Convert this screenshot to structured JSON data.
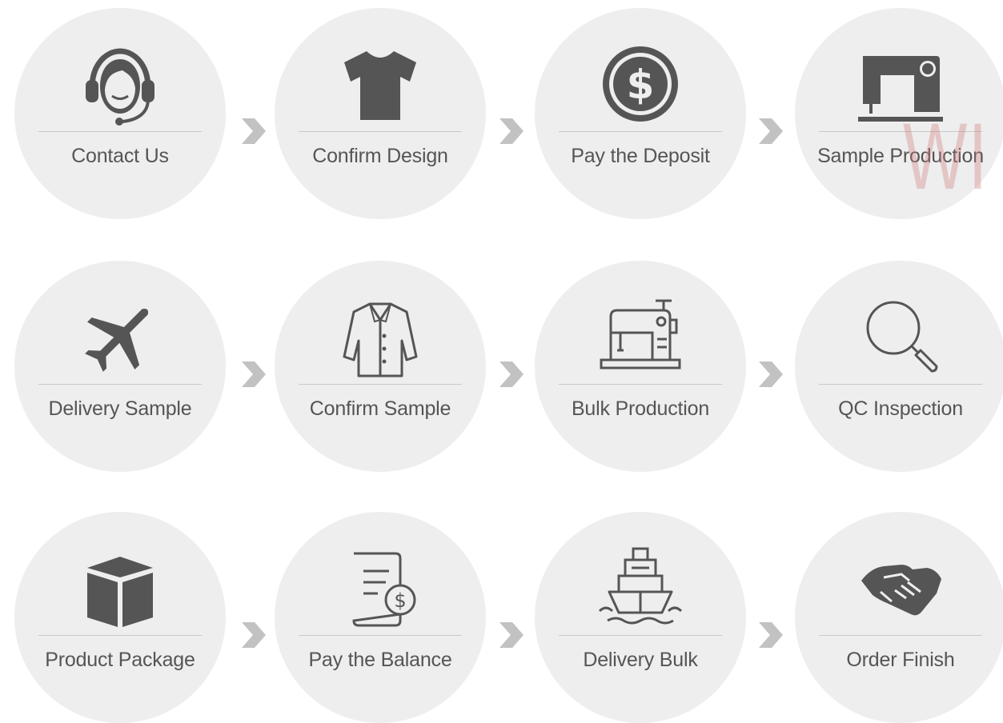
{
  "steps": [
    {
      "label": "Contact Us",
      "icon": "headset-operator-icon"
    },
    {
      "label": "Confirm Design",
      "icon": "tshirt-icon"
    },
    {
      "label": "Pay the Deposit",
      "icon": "dollar-coin-icon"
    },
    {
      "label": "Sample Production",
      "icon": "industrial-sewing-machine-icon"
    },
    {
      "label": "Delivery Sample",
      "icon": "airplane-icon"
    },
    {
      "label": "Confirm Sample",
      "icon": "coat-icon"
    },
    {
      "label": "Bulk Production",
      "icon": "sewing-machine-icon"
    },
    {
      "label": "QC Inspection",
      "icon": "magnifier-icon"
    },
    {
      "label": "Product Package",
      "icon": "box-icon"
    },
    {
      "label": "Pay the Balance",
      "icon": "invoice-dollar-icon"
    },
    {
      "label": "Delivery Bulk",
      "icon": "ship-icon"
    },
    {
      "label": "Order Finish",
      "icon": "handshake-icon"
    }
  ],
  "watermark": "WI",
  "colors": {
    "circle": "#eeeeee",
    "icon": "#555555",
    "arrow": "#c2c2c2",
    "label": "#555555",
    "divider": "#c9c9c9"
  }
}
